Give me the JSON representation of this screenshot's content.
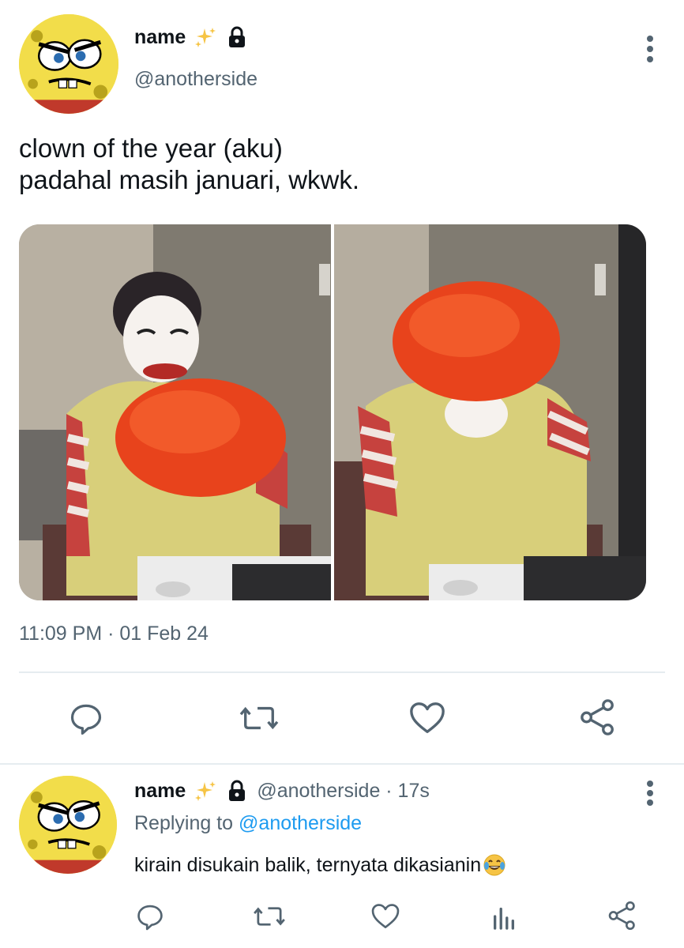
{
  "tweet": {
    "author": {
      "display_name": "name",
      "handle": "@anotherside",
      "badge_icon": "sparkles-icon",
      "protected_icon": "lock-icon"
    },
    "text_lines": [
      "clown of the year (aku)",
      "padahal masih januari, wkwk."
    ],
    "timestamp": "11:09 PM · 01 Feb 24",
    "actions": [
      "reply-icon",
      "retweet-icon",
      "like-icon",
      "share-icon"
    ]
  },
  "reply": {
    "author": {
      "display_name": "name",
      "handle_time": "@anotherside · 17s"
    },
    "replying_prefix": "Replying to ",
    "replying_to": "@anotherside",
    "text": "kirain disukain balik, ternyata dikasianin",
    "emoji_icon": "laughing-tears-emoji",
    "actions": [
      "reply-icon",
      "retweet-icon",
      "like-icon",
      "analytics-icon",
      "share-icon"
    ]
  },
  "colors": {
    "text_primary": "#0f1419",
    "text_secondary": "#536471",
    "link": "#1d9bf0",
    "divider": "#e6ecf0"
  }
}
